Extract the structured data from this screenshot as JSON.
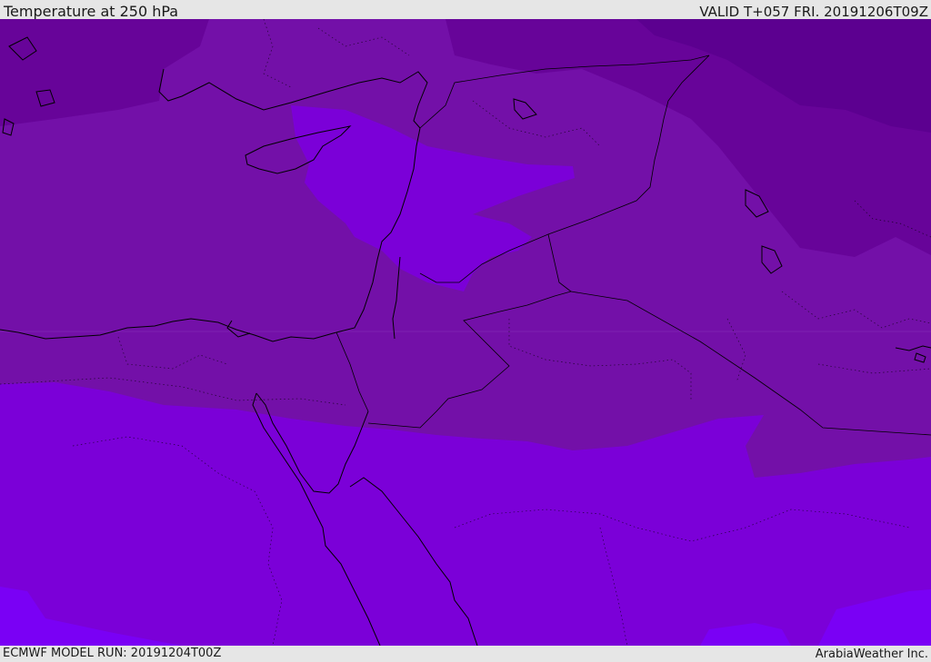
{
  "header": {
    "title": "Temperature at 250 hPa",
    "valid": "VALID T+057 FRI. 20191206T09Z"
  },
  "footer": {
    "model_run": "ECMWF MODEL RUN: 20191204T00Z",
    "credit": "ArabiaWeather Inc."
  },
  "map": {
    "field": "Temperature at 250 hPa",
    "colors": {
      "darkest": "#5c0090",
      "dark": "#670499",
      "mid": "#7310a8",
      "bright": "#7b00d8",
      "brightest": "#7a00f5",
      "coastline": "#000000"
    }
  }
}
